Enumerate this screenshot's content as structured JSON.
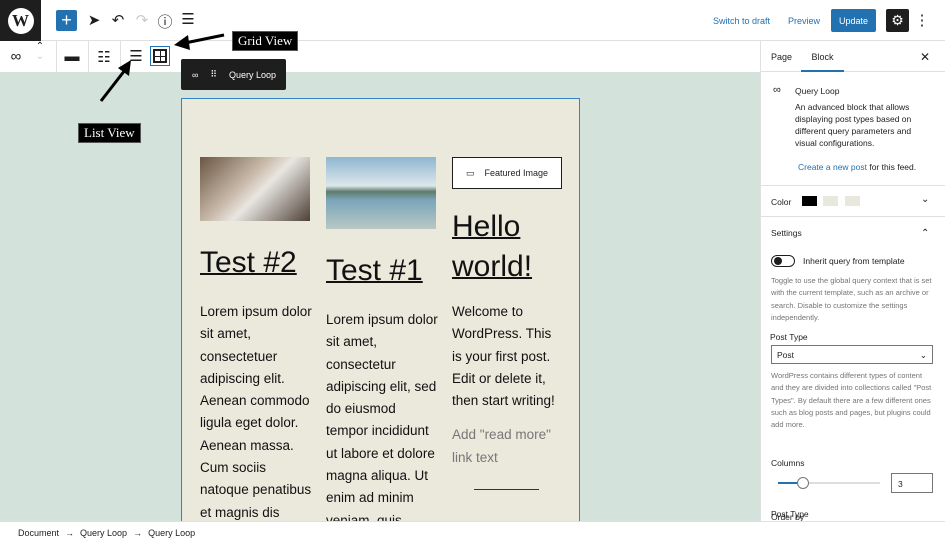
{
  "topbar": {
    "logo": "W",
    "add": "+",
    "switch_draft": "Switch to draft",
    "preview": "Preview",
    "update": "Update"
  },
  "annotations": {
    "grid_view": "Grid View",
    "list_view": "List View"
  },
  "toolbar": {
    "tooltip": "Query Loop"
  },
  "posts": [
    {
      "title": "Test #2",
      "body": "Lorem ipsum dolor sit amet, consectetuer adipiscing elit. Aenean commodo ligula eget dolor. Aenean massa. Cum sociis natoque penatibus et magnis dis"
    },
    {
      "title": "Test #1",
      "body": "Lorem ipsum dolor sit amet, consectetur adipiscing elit, sed do eiusmod tempor incididunt ut labore et dolore magna aliqua. Ut enim ad minim veniam, quis"
    },
    {
      "title": "Hello world!",
      "featured": "Featured Image",
      "body": "Welcome to WordPress. This is your first post. Edit or delete it, then start writing!",
      "read_more": "Add \"read more\" link text"
    }
  ],
  "sidebar": {
    "tab_page": "Page",
    "tab_block": "Block",
    "block_name": "Query Loop",
    "block_desc": "An advanced block that allows displaying post types based on different query parameters and visual configurations.",
    "create_link": "Create a new post",
    "create_suffix": " for this feed.",
    "color_label": "Color",
    "colors": [
      "#000000",
      "#e8e8dc",
      "#e8e8dc"
    ],
    "settings_label": "Settings",
    "inherit_label": "Inherit query from template",
    "inherit_help": "Toggle to use the global query context that is set with the current template, such as an archive or search. Disable to customize the settings independently.",
    "post_type_label": "Post Type",
    "post_type_value": "Post",
    "post_type_help": "WordPress contains different types of content and they are divided into collections called \"Post Types\". By default there are a few different ones such as blog posts and pages, but plugins could add more.",
    "columns_label": "Columns",
    "columns_value": "3",
    "order_label": "Order by"
  },
  "breadcrumb": [
    "Document",
    "Query Loop",
    "Query Loop"
  ]
}
